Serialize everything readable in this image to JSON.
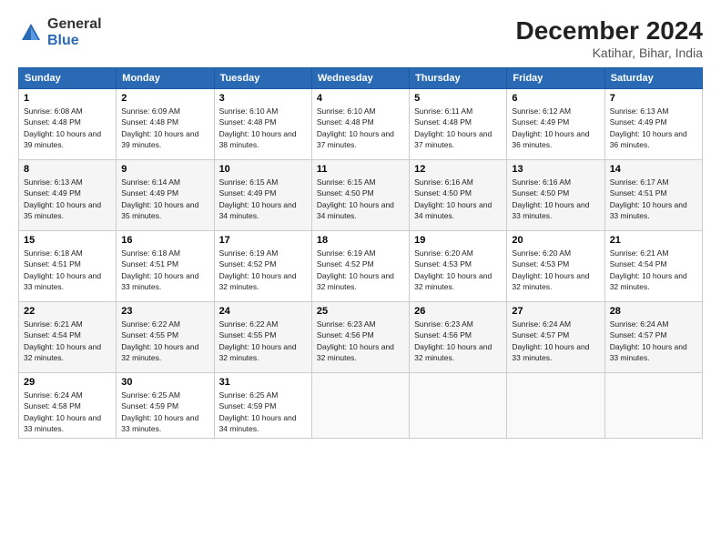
{
  "logo": {
    "general": "General",
    "blue": "Blue"
  },
  "title": "December 2024",
  "location": "Katihar, Bihar, India",
  "weekdays": [
    "Sunday",
    "Monday",
    "Tuesday",
    "Wednesday",
    "Thursday",
    "Friday",
    "Saturday"
  ],
  "weeks": [
    [
      {
        "day": "1",
        "sunrise": "6:08 AM",
        "sunset": "4:48 PM",
        "daylight": "10 hours and 39 minutes."
      },
      {
        "day": "2",
        "sunrise": "6:09 AM",
        "sunset": "4:48 PM",
        "daylight": "10 hours and 39 minutes."
      },
      {
        "day": "3",
        "sunrise": "6:10 AM",
        "sunset": "4:48 PM",
        "daylight": "10 hours and 38 minutes."
      },
      {
        "day": "4",
        "sunrise": "6:10 AM",
        "sunset": "4:48 PM",
        "daylight": "10 hours and 37 minutes."
      },
      {
        "day": "5",
        "sunrise": "6:11 AM",
        "sunset": "4:48 PM",
        "daylight": "10 hours and 37 minutes."
      },
      {
        "day": "6",
        "sunrise": "6:12 AM",
        "sunset": "4:49 PM",
        "daylight": "10 hours and 36 minutes."
      },
      {
        "day": "7",
        "sunrise": "6:13 AM",
        "sunset": "4:49 PM",
        "daylight": "10 hours and 36 minutes."
      }
    ],
    [
      {
        "day": "8",
        "sunrise": "6:13 AM",
        "sunset": "4:49 PM",
        "daylight": "10 hours and 35 minutes."
      },
      {
        "day": "9",
        "sunrise": "6:14 AM",
        "sunset": "4:49 PM",
        "daylight": "10 hours and 35 minutes."
      },
      {
        "day": "10",
        "sunrise": "6:15 AM",
        "sunset": "4:49 PM",
        "daylight": "10 hours and 34 minutes."
      },
      {
        "day": "11",
        "sunrise": "6:15 AM",
        "sunset": "4:50 PM",
        "daylight": "10 hours and 34 minutes."
      },
      {
        "day": "12",
        "sunrise": "6:16 AM",
        "sunset": "4:50 PM",
        "daylight": "10 hours and 34 minutes."
      },
      {
        "day": "13",
        "sunrise": "6:16 AM",
        "sunset": "4:50 PM",
        "daylight": "10 hours and 33 minutes."
      },
      {
        "day": "14",
        "sunrise": "6:17 AM",
        "sunset": "4:51 PM",
        "daylight": "10 hours and 33 minutes."
      }
    ],
    [
      {
        "day": "15",
        "sunrise": "6:18 AM",
        "sunset": "4:51 PM",
        "daylight": "10 hours and 33 minutes."
      },
      {
        "day": "16",
        "sunrise": "6:18 AM",
        "sunset": "4:51 PM",
        "daylight": "10 hours and 33 minutes."
      },
      {
        "day": "17",
        "sunrise": "6:19 AM",
        "sunset": "4:52 PM",
        "daylight": "10 hours and 32 minutes."
      },
      {
        "day": "18",
        "sunrise": "6:19 AM",
        "sunset": "4:52 PM",
        "daylight": "10 hours and 32 minutes."
      },
      {
        "day": "19",
        "sunrise": "6:20 AM",
        "sunset": "4:53 PM",
        "daylight": "10 hours and 32 minutes."
      },
      {
        "day": "20",
        "sunrise": "6:20 AM",
        "sunset": "4:53 PM",
        "daylight": "10 hours and 32 minutes."
      },
      {
        "day": "21",
        "sunrise": "6:21 AM",
        "sunset": "4:54 PM",
        "daylight": "10 hours and 32 minutes."
      }
    ],
    [
      {
        "day": "22",
        "sunrise": "6:21 AM",
        "sunset": "4:54 PM",
        "daylight": "10 hours and 32 minutes."
      },
      {
        "day": "23",
        "sunrise": "6:22 AM",
        "sunset": "4:55 PM",
        "daylight": "10 hours and 32 minutes."
      },
      {
        "day": "24",
        "sunrise": "6:22 AM",
        "sunset": "4:55 PM",
        "daylight": "10 hours and 32 minutes."
      },
      {
        "day": "25",
        "sunrise": "6:23 AM",
        "sunset": "4:56 PM",
        "daylight": "10 hours and 32 minutes."
      },
      {
        "day": "26",
        "sunrise": "6:23 AM",
        "sunset": "4:56 PM",
        "daylight": "10 hours and 32 minutes."
      },
      {
        "day": "27",
        "sunrise": "6:24 AM",
        "sunset": "4:57 PM",
        "daylight": "10 hours and 33 minutes."
      },
      {
        "day": "28",
        "sunrise": "6:24 AM",
        "sunset": "4:57 PM",
        "daylight": "10 hours and 33 minutes."
      }
    ],
    [
      {
        "day": "29",
        "sunrise": "6:24 AM",
        "sunset": "4:58 PM",
        "daylight": "10 hours and 33 minutes."
      },
      {
        "day": "30",
        "sunrise": "6:25 AM",
        "sunset": "4:59 PM",
        "daylight": "10 hours and 33 minutes."
      },
      {
        "day": "31",
        "sunrise": "6:25 AM",
        "sunset": "4:59 PM",
        "daylight": "10 hours and 34 minutes."
      },
      null,
      null,
      null,
      null
    ]
  ]
}
